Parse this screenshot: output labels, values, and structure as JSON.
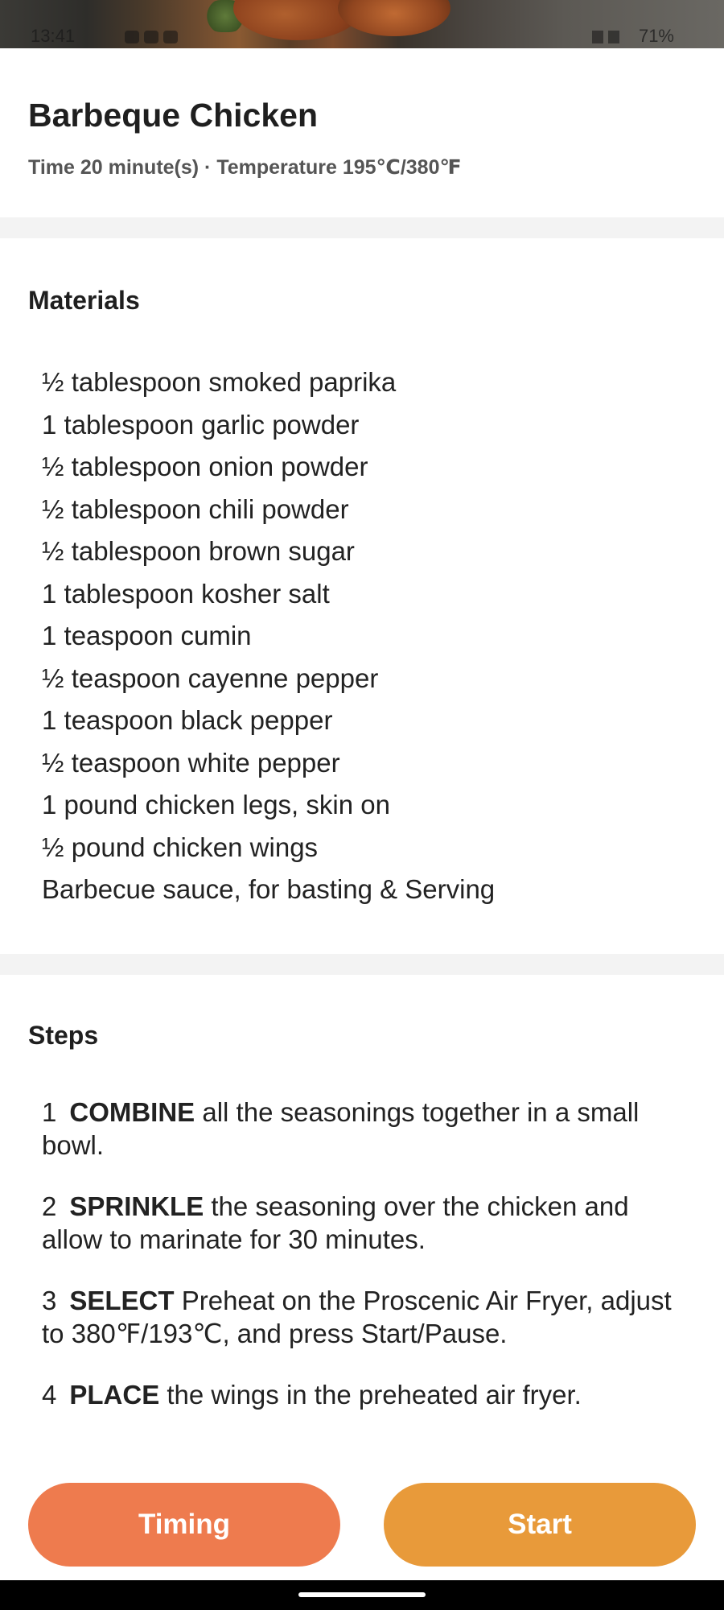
{
  "status_bar": {
    "time": "13:41",
    "battery": "71%"
  },
  "recipe": {
    "title": "Barbeque Chicken",
    "subtitle": "Time 20 minute(s) · Temperature 195℃/380℉"
  },
  "materials": {
    "title": "Materials",
    "items": [
      "½ tablespoon smoked paprika",
      "1 tablespoon garlic powder",
      "½ tablespoon onion powder",
      "½ tablespoon chili powder",
      "½ tablespoon brown sugar",
      "1 tablespoon kosher salt",
      "1 teaspoon cumin",
      "½ teaspoon cayenne pepper",
      "1 teaspoon black pepper",
      "½ teaspoon white pepper",
      "1 pound chicken legs, skin on",
      "½ pound chicken wings",
      "Barbecue sauce, for basting & Serving"
    ]
  },
  "steps": {
    "title": "Steps",
    "items": [
      {
        "num": "1",
        "verb": "COMBINE",
        "text": " all the seasonings together in a small bowl."
      },
      {
        "num": "2",
        "verb": "SPRINKLE",
        "text": " the seasoning over the chicken and allow to marinate for 30 minutes."
      },
      {
        "num": "3",
        "verb": "SELECT",
        "text": " Preheat on the Proscenic  Air Fryer, adjust to 380℉/193℃, and press Start/Pause."
      },
      {
        "num": "4",
        "verb": "PLACE",
        "text": " the wings in the preheated air fryer."
      }
    ]
  },
  "buttons": {
    "timing_label": "Timing",
    "start_label": "Start",
    "timing_color": "#ee7b4e",
    "start_color": "#e89a3a"
  }
}
